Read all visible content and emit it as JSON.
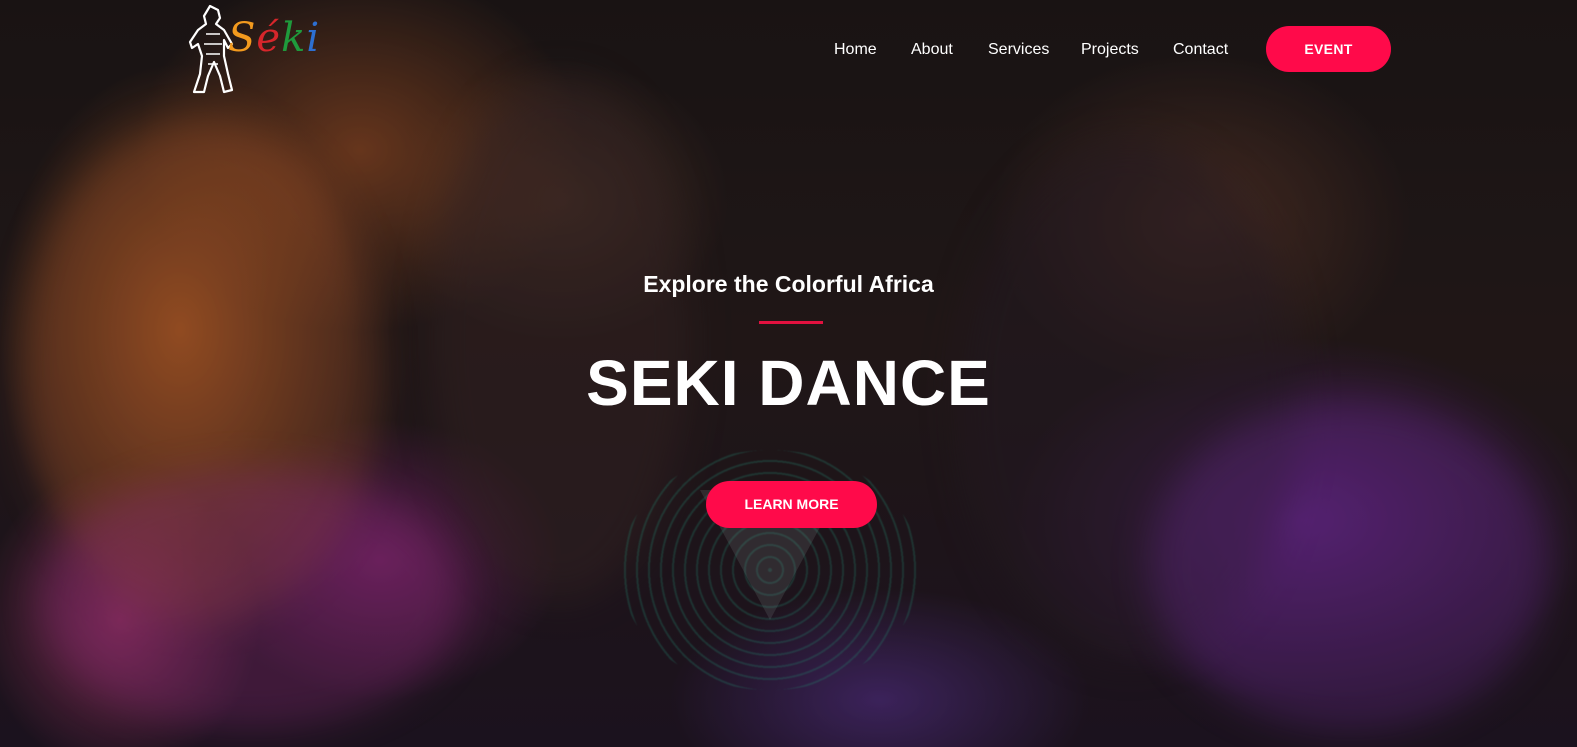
{
  "brand": {
    "logo_text": "Séki",
    "logo_letters": [
      "S",
      "é",
      "k",
      "i"
    ]
  },
  "nav": {
    "items": [
      {
        "label": "Home"
      },
      {
        "label": "About"
      },
      {
        "label": "Services"
      },
      {
        "label": "Projects"
      },
      {
        "label": "Contact"
      }
    ],
    "cta_label": "EVENT"
  },
  "hero": {
    "subtitle": "Explore the Colorful Africa",
    "title": "SEKI DANCE",
    "button_label": "LEARN MORE"
  },
  "colors": {
    "accent": "#ff0a4a",
    "divider": "#e2113f",
    "text": "#ffffff",
    "logo_orange": "#f39a1e",
    "logo_red": "#d7262b",
    "logo_green": "#1f9a3c",
    "logo_blue": "#2d6fd1"
  }
}
